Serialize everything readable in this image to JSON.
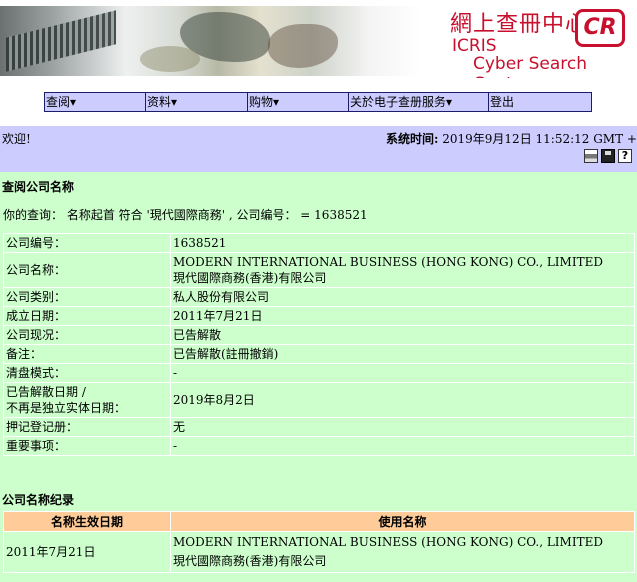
{
  "banner": {
    "logo_cn": "網上查冊中心",
    "logo_cr": "CR",
    "logo_icris": "ICRIS",
    "logo_tagline": "Cyber Search Centre"
  },
  "menu": [
    {
      "label": "查阅▾"
    },
    {
      "label": "资料▾"
    },
    {
      "label": "购物▾"
    },
    {
      "label": "关於电子查册服务▾"
    },
    {
      "label": "登出"
    }
  ],
  "welcome": {
    "greeting": "欢迎!",
    "systime_label": "系统时间:",
    "systime_value": " 2019年9月12日 11:52:12 GMT +0800"
  },
  "toolbar_icons": [
    "print-icon",
    "save-icon",
    "help-icon"
  ],
  "search": {
    "title": "查阅公司名称",
    "query": "你的查询： 名称起首 符合 '現代國際商務' , 公司编号： = 1638521"
  },
  "company": {
    "rows": [
      {
        "label": "公司编号：",
        "value": "1638521"
      },
      {
        "label": "公司名称：",
        "value": "MODERN INTERNATIONAL BUSINESS (HONG KONG) CO., LIMITED",
        "value2": "現代國際商務(香港)有限公司"
      },
      {
        "label": "公司类别：",
        "value": "私人股份有限公司"
      },
      {
        "label": "成立日期：",
        "value": "2011年7月21日"
      },
      {
        "label": "公司现况：",
        "value": "已告解散"
      },
      {
        "label": "备注：",
        "value": "已告解散(註冊撤銷)"
      },
      {
        "label": "清盘模式：",
        "value": "-"
      },
      {
        "label": "已告解散日期 /",
        "label2": "不再是独立实体日期：",
        "value": "2019年8月2日"
      },
      {
        "label": "押记登记册：",
        "value": "无"
      },
      {
        "label": "重要事项：",
        "value": "-"
      }
    ]
  },
  "history": {
    "title": "公司名称纪录",
    "headers": [
      "名称生效日期",
      "使用名称"
    ],
    "rows": [
      {
        "date": "2011年7月21日",
        "name_en": "MODERN INTERNATIONAL BUSINESS (HONG KONG) CO., LIMITED",
        "name_cn": "現代國際商務(香港)有限公司"
      }
    ]
  },
  "colors": {
    "menu_bg": "#ccccff",
    "content_bg": "#ccffcc",
    "table_header_bg": "#ffcc99",
    "brand_red": "#c8102e"
  }
}
